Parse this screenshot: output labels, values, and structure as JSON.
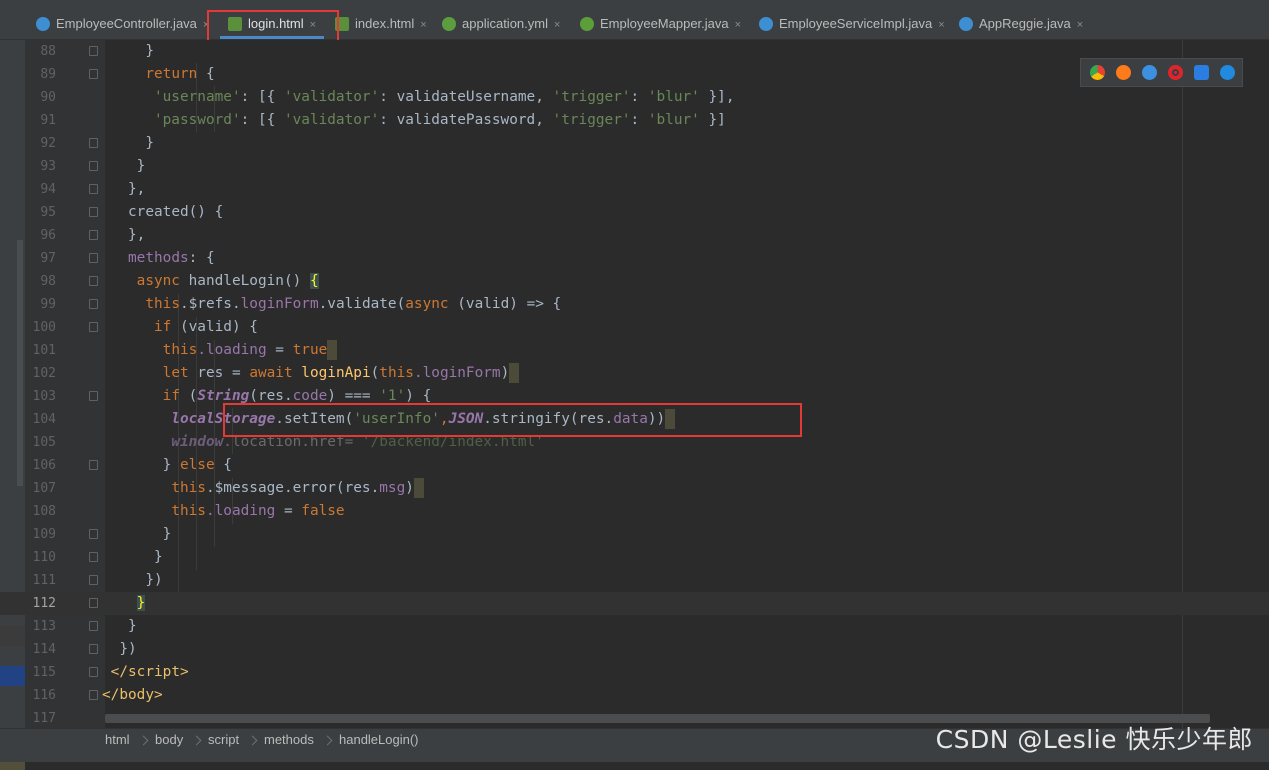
{
  "tabs": [
    {
      "label": "EmployeeController.java",
      "icon": "java-class-icon",
      "color": "#3d8fd1"
    },
    {
      "label": "login.html",
      "icon": "html-file-icon",
      "color": "#5a8f3c",
      "active": true
    },
    {
      "label": "index.html",
      "icon": "html-file-icon",
      "color": "#5a8f3c"
    },
    {
      "label": "application.yml",
      "icon": "yaml-file-icon",
      "color": "#5c9e3f"
    },
    {
      "label": "EmployeeMapper.java",
      "icon": "java-interface-icon",
      "color": "#5b9e3a"
    },
    {
      "label": "EmployeeServiceImpl.java",
      "icon": "java-class-icon",
      "color": "#3d8fd1"
    },
    {
      "label": "AppReggie.java",
      "icon": "java-class-icon",
      "color": "#3d8fd1"
    }
  ],
  "close_glyph": "×",
  "line_numbers": [
    "88",
    "89",
    "90",
    "91",
    "92",
    "93",
    "94",
    "95",
    "96",
    "97",
    "98",
    "99",
    "100",
    "101",
    "102",
    "103",
    "104",
    "105",
    "106",
    "107",
    "108",
    "109",
    "110",
    "111",
    "112",
    "113",
    "114",
    "115",
    "116",
    "117"
  ],
  "code": {
    "l88": "}",
    "l89_kw": "return",
    "l89_rest": " {",
    "l90_k": "'username'",
    "l90_a": ": [{ ",
    "l90_v": "'validator'",
    "l90_b": ": validateUsername, ",
    "l90_t": "'trigger'",
    "l90_c": ": ",
    "l90_bl": "'blur'",
    "l90_d": " }],",
    "l91_k": "'password'",
    "l91_a": ": [{ ",
    "l91_v": "'validator'",
    "l91_b": ": validatePassword, ",
    "l91_t": "'trigger'",
    "l91_c": ": ",
    "l91_bl": "'blur'",
    "l91_d": " }]",
    "l92": "}",
    "l93": "}",
    "l94": "},",
    "l95": "created() {",
    "l96": "},",
    "l97_a": "methods",
    "l97_b": ": {",
    "l98_kw": "async",
    "l98_fn": " handleLogin",
    "l98_rest": "() ",
    "l98_brace": "{",
    "l99_this": "this",
    "l99_a": ".$refs.",
    "l99_p": "loginForm",
    "l99_b": ".validate(",
    "l99_kw": "async",
    "l99_c": " (valid) => {",
    "l100_kw": "if",
    "l100_rest": " (valid) {",
    "l101_this": "this",
    "l101_p": ".loading",
    "l101_a": " = ",
    "l101_kw": "true",
    "l102_kw": "let",
    "l102_a": " res = ",
    "l102_aw": "await",
    "l102_fn": " loginApi",
    "l102_b": "(",
    "l102_this": "this",
    "l102_p": ".loginForm",
    "l102_c": ")",
    "l103_kw": "if",
    "l103_a": " (",
    "l103_cls": "String",
    "l103_b": "(res.",
    "l103_p": "code",
    "l103_c": ") === ",
    "l103_s": "'1'",
    "l103_d": ") {",
    "l104_ls": "localStorage",
    "l104_a": ".setItem(",
    "l104_s": "'userInfo'",
    "l104_b": ",",
    "l104_js": "JSON",
    "l104_c": ".stringify(res.",
    "l104_p": "data",
    "l104_d": "))",
    "l105_w": "window",
    "l105_a": ".location.href= ",
    "l105_s": "'/backend/index.html'",
    "l106_a": "} ",
    "l106_kw": "else",
    "l106_b": " {",
    "l107_this": "this",
    "l107_a": ".$message.error(res.",
    "l107_p": "msg",
    "l107_b": ")",
    "l108_this": "this",
    "l108_p": ".loading",
    "l108_a": " = ",
    "l108_kw": "false",
    "l109": "}",
    "l110": "}",
    "l111": "})",
    "l112": "}",
    "l113": "}",
    "l114": "})",
    "l115_a": "</",
    "l115_t": "script",
    "l115_b": ">",
    "l116_a": "</",
    "l116_t": "body",
    "l116_b": ">"
  },
  "breadcrumbs": [
    "html",
    "body",
    "script",
    "methods",
    "handleLogin()"
  ],
  "browser_icons": [
    {
      "name": "chrome-icon",
      "color": "#e34234"
    },
    {
      "name": "firefox-icon",
      "color": "#ff7a1a"
    },
    {
      "name": "safari-icon",
      "color": "#3d8fe0"
    },
    {
      "name": "opera-icon",
      "color": "#e0242d"
    },
    {
      "name": "ie-icon",
      "color": "#2a7de1"
    },
    {
      "name": "edge-icon",
      "color": "#1f8ae0"
    }
  ],
  "watermark": "CSDN @Leslie 快乐少年郎"
}
